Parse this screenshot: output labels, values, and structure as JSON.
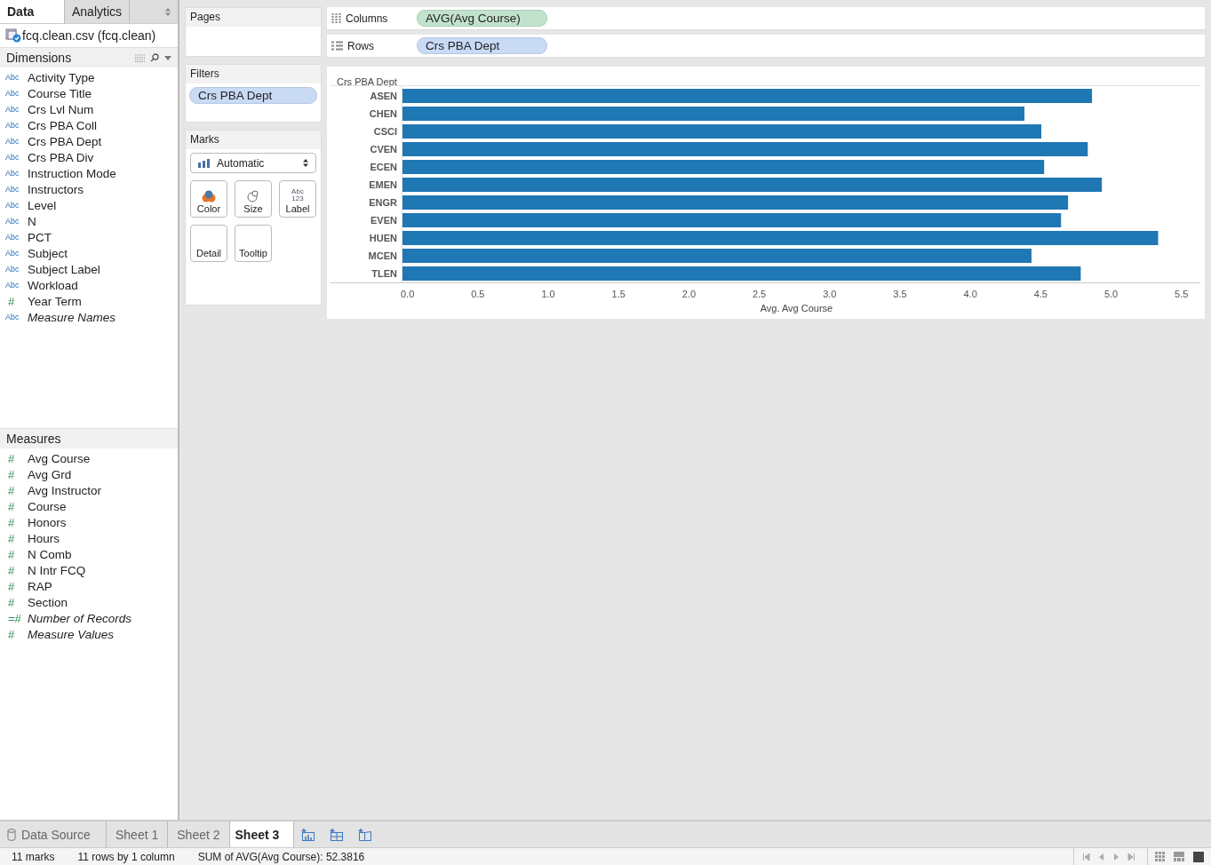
{
  "side_tabs": [
    {
      "label": "Data",
      "selected": true
    },
    {
      "label": "Analytics",
      "selected": false
    }
  ],
  "data_source": "fcq.clean.csv (fcq.clean)",
  "dimensions": {
    "title": "Dimensions",
    "fields": [
      {
        "glyph": "Abc",
        "kind": "discrete",
        "name": "Activity Type",
        "italic": false
      },
      {
        "glyph": "Abc",
        "kind": "discrete",
        "name": "Course Title",
        "italic": false
      },
      {
        "glyph": "Abc",
        "kind": "discrete",
        "name": "Crs Lvl Num",
        "italic": false
      },
      {
        "glyph": "Abc",
        "kind": "discrete",
        "name": "Crs PBA Coll",
        "italic": false
      },
      {
        "glyph": "Abc",
        "kind": "discrete",
        "name": "Crs PBA Dept",
        "italic": false
      },
      {
        "glyph": "Abc",
        "kind": "discrete",
        "name": "Crs PBA Div",
        "italic": false
      },
      {
        "glyph": "Abc",
        "kind": "discrete",
        "name": "Instruction Mode",
        "italic": false
      },
      {
        "glyph": "Abc",
        "kind": "discrete",
        "name": "Instructors",
        "italic": false
      },
      {
        "glyph": "Abc",
        "kind": "discrete",
        "name": "Level",
        "italic": false
      },
      {
        "glyph": "Abc",
        "kind": "discrete",
        "name": "N",
        "italic": false
      },
      {
        "glyph": "Abc",
        "kind": "discrete",
        "name": "PCT",
        "italic": false
      },
      {
        "glyph": "Abc",
        "kind": "discrete",
        "name": "Subject",
        "italic": false
      },
      {
        "glyph": "Abc",
        "kind": "discrete",
        "name": "Subject Label",
        "italic": false
      },
      {
        "glyph": "Abc",
        "kind": "discrete",
        "name": "Workload",
        "italic": false
      },
      {
        "glyph": "#",
        "kind": "continuous",
        "name": "Year Term",
        "italic": false
      },
      {
        "glyph": "Abc",
        "kind": "discrete",
        "name": "Measure Names",
        "italic": true
      }
    ]
  },
  "measures": {
    "title": "Measures",
    "fields": [
      {
        "glyph": "#",
        "kind": "continuous",
        "name": "Avg Course",
        "italic": false
      },
      {
        "glyph": "#",
        "kind": "continuous",
        "name": "Avg Grd",
        "italic": false
      },
      {
        "glyph": "#",
        "kind": "continuous",
        "name": "Avg Instructor",
        "italic": false
      },
      {
        "glyph": "#",
        "kind": "continuous",
        "name": "Course",
        "italic": false
      },
      {
        "glyph": "#",
        "kind": "continuous",
        "name": "Honors",
        "italic": false
      },
      {
        "glyph": "#",
        "kind": "continuous",
        "name": "Hours",
        "italic": false
      },
      {
        "glyph": "#",
        "kind": "continuous",
        "name": "N Comb",
        "italic": false
      },
      {
        "glyph": "#",
        "kind": "continuous",
        "name": "N Intr FCQ",
        "italic": false
      },
      {
        "glyph": "#",
        "kind": "continuous",
        "name": "RAP",
        "italic": false
      },
      {
        "glyph": "#",
        "kind": "continuous",
        "name": "Section",
        "italic": false
      },
      {
        "glyph": "=#",
        "kind": "continuous",
        "name": "Number of Records",
        "italic": true
      },
      {
        "glyph": "#",
        "kind": "continuous",
        "name": "Measure Values",
        "italic": true
      }
    ]
  },
  "pages": {
    "title": "Pages"
  },
  "filters": {
    "title": "Filters",
    "pills": [
      {
        "label": "Crs PBA Dept",
        "kind": "dimension"
      }
    ]
  },
  "marks": {
    "title": "Marks",
    "mark_type": "Automatic",
    "buttons": [
      {
        "kind": "color",
        "label": "Color"
      },
      {
        "kind": "size",
        "label": "Size"
      },
      {
        "kind": "label",
        "label": "Label",
        "glyph_lines": [
          "Abc",
          "123"
        ]
      },
      {
        "kind": "detail",
        "label": "Detail"
      },
      {
        "kind": "tooltip",
        "label": "Tooltip"
      }
    ]
  },
  "shelves": [
    {
      "kind": "columns",
      "label": "Columns",
      "pill": {
        "label": "AVG(Avg Course)",
        "kind": "measure"
      }
    },
    {
      "kind": "rows",
      "label": "Rows",
      "pill": {
        "label": "Crs PBA Dept",
        "kind": "dimension"
      }
    }
  ],
  "chart_data": {
    "type": "bar",
    "orientation": "horizontal",
    "title": "Crs PBA Dept",
    "xlabel": "Avg. Avg Course",
    "categories": [
      "ASEN",
      "CHEN",
      "CSCI",
      "CVEN",
      "ECEN",
      "EMEN",
      "ENGR",
      "EVEN",
      "HUEN",
      "MCEN",
      "TLEN"
    ],
    "series": [
      {
        "color": "#1f77b4",
        "values": [
          4.9,
          4.42,
          4.54,
          4.87,
          4.56,
          4.97,
          4.73,
          4.68,
          5.37,
          4.47,
          4.82
        ]
      }
    ],
    "xlim": [
      0,
      5.67
    ],
    "xticks": [
      {
        "value": 0,
        "label": "0.0"
      },
      {
        "value": 0.5,
        "label": "0.5"
      },
      {
        "value": 1,
        "label": "1.0"
      },
      {
        "value": 1.5,
        "label": "1.5"
      },
      {
        "value": 2,
        "label": "2.0"
      },
      {
        "value": 2.5,
        "label": "2.5"
      },
      {
        "value": 3,
        "label": "3.0"
      },
      {
        "value": 3.5,
        "label": "3.5"
      },
      {
        "value": 4,
        "label": "4.0"
      },
      {
        "value": 4.5,
        "label": "4.5"
      },
      {
        "value": 5,
        "label": "5.0"
      },
      {
        "value": 5.5,
        "label": "5.5"
      }
    ]
  },
  "sheet_tabs": [
    {
      "kind": "datasource",
      "label": "Data Source",
      "selected": false
    },
    {
      "kind": "sheet",
      "label": "Sheet 1",
      "selected": false
    },
    {
      "kind": "sheet",
      "label": "Sheet 2",
      "selected": false
    },
    {
      "kind": "sheet",
      "label": "Sheet 3",
      "selected": true
    }
  ],
  "status_bar": [
    "11 marks",
    "11 rows by 1 column",
    "SUM of AVG(Avg Course): 52.3816"
  ]
}
